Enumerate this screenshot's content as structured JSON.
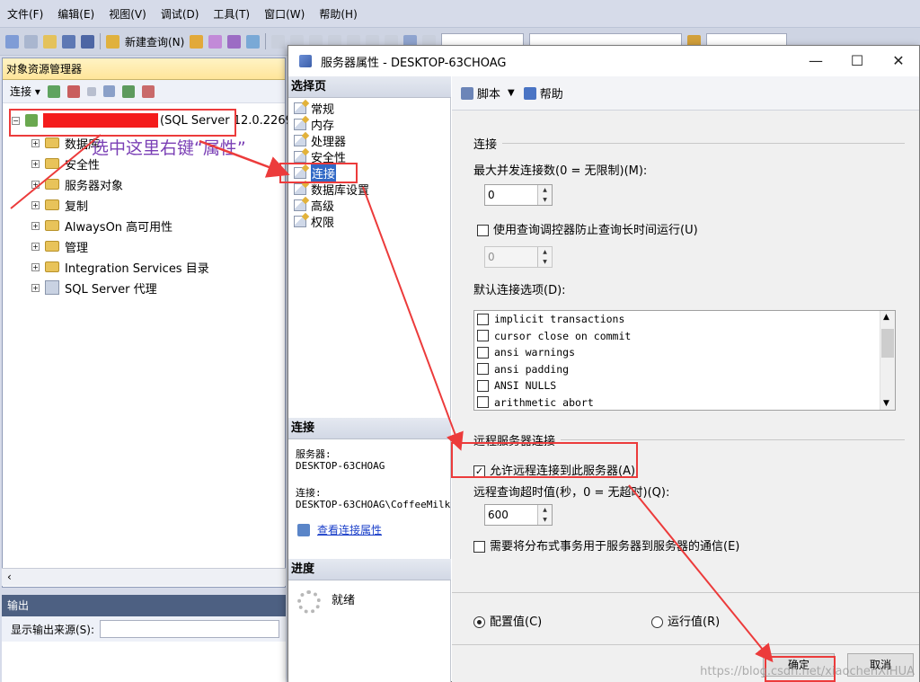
{
  "menu": [
    "文件(F)",
    "编辑(E)",
    "视图(V)",
    "调试(D)",
    "工具(T)",
    "窗口(W)",
    "帮助(H)"
  ],
  "toolbar": {
    "new_query": "新建查询(N)"
  },
  "object_explorer": {
    "title": "对象资源管理器",
    "connect_label": "连接",
    "server_suffix": "(SQL Server 12.0.2269",
    "nodes": [
      "数据库",
      "安全性",
      "服务器对象",
      "复制",
      "AlwaysOn 高可用性",
      "管理",
      "Integration Services 目录",
      "SQL Server 代理"
    ]
  },
  "annotation": {
    "note": "选中这里右键“属性”"
  },
  "output": {
    "title": "输出",
    "source_label": "显示输出来源(S):"
  },
  "dialog": {
    "title": "服务器属性 - DESKTOP-63CHOAG",
    "select_page": "选择页",
    "pages": [
      "常规",
      "内存",
      "处理器",
      "安全性",
      "连接",
      "数据库设置",
      "高级",
      "权限"
    ],
    "script_label": "脚本",
    "help_label": "帮助",
    "conn_head": "连接",
    "server_label": "服务器:",
    "server_value": "DESKTOP-63CHOAG",
    "connection_label": "连接:",
    "connection_value": "DESKTOP-63CHOAG\\CoffeeMilk",
    "view_props": "查看连接属性",
    "progress_head": "进度",
    "progress_status": "就绪",
    "group_connections": "连接",
    "max_connections_label": "最大并发连接数(0 = 无限制)(M):",
    "max_connections_value": "0",
    "query_governor_label": "使用查询调控器防止查询长时间运行(U)",
    "query_governor_value": "0",
    "default_options_label": "默认连接选项(D):",
    "options": [
      "implicit transactions",
      "cursor close on commit",
      "ansi warnings",
      "ansi padding",
      "ANSI NULLS",
      "arithmetic abort"
    ],
    "group_remote": "远程服务器连接",
    "allow_remote_label": "允许远程连接到此服务器(A)",
    "remote_timeout_label": "远程查询超时值(秒，0 = 无超时)(Q):",
    "remote_timeout_value": "600",
    "distributed_label": "需要将分布式事务用于服务器到服务器的通信(E)",
    "configured_label": "配置值(C)",
    "running_label": "运行值(R)",
    "ok_label": "确定",
    "cancel_label": "取消"
  },
  "watermark": "https://blog.csdn.net/xiaochenXIHUA",
  "colors": {
    "annotation_red": "#ec3b3b",
    "selection_blue": "#3169c6"
  }
}
